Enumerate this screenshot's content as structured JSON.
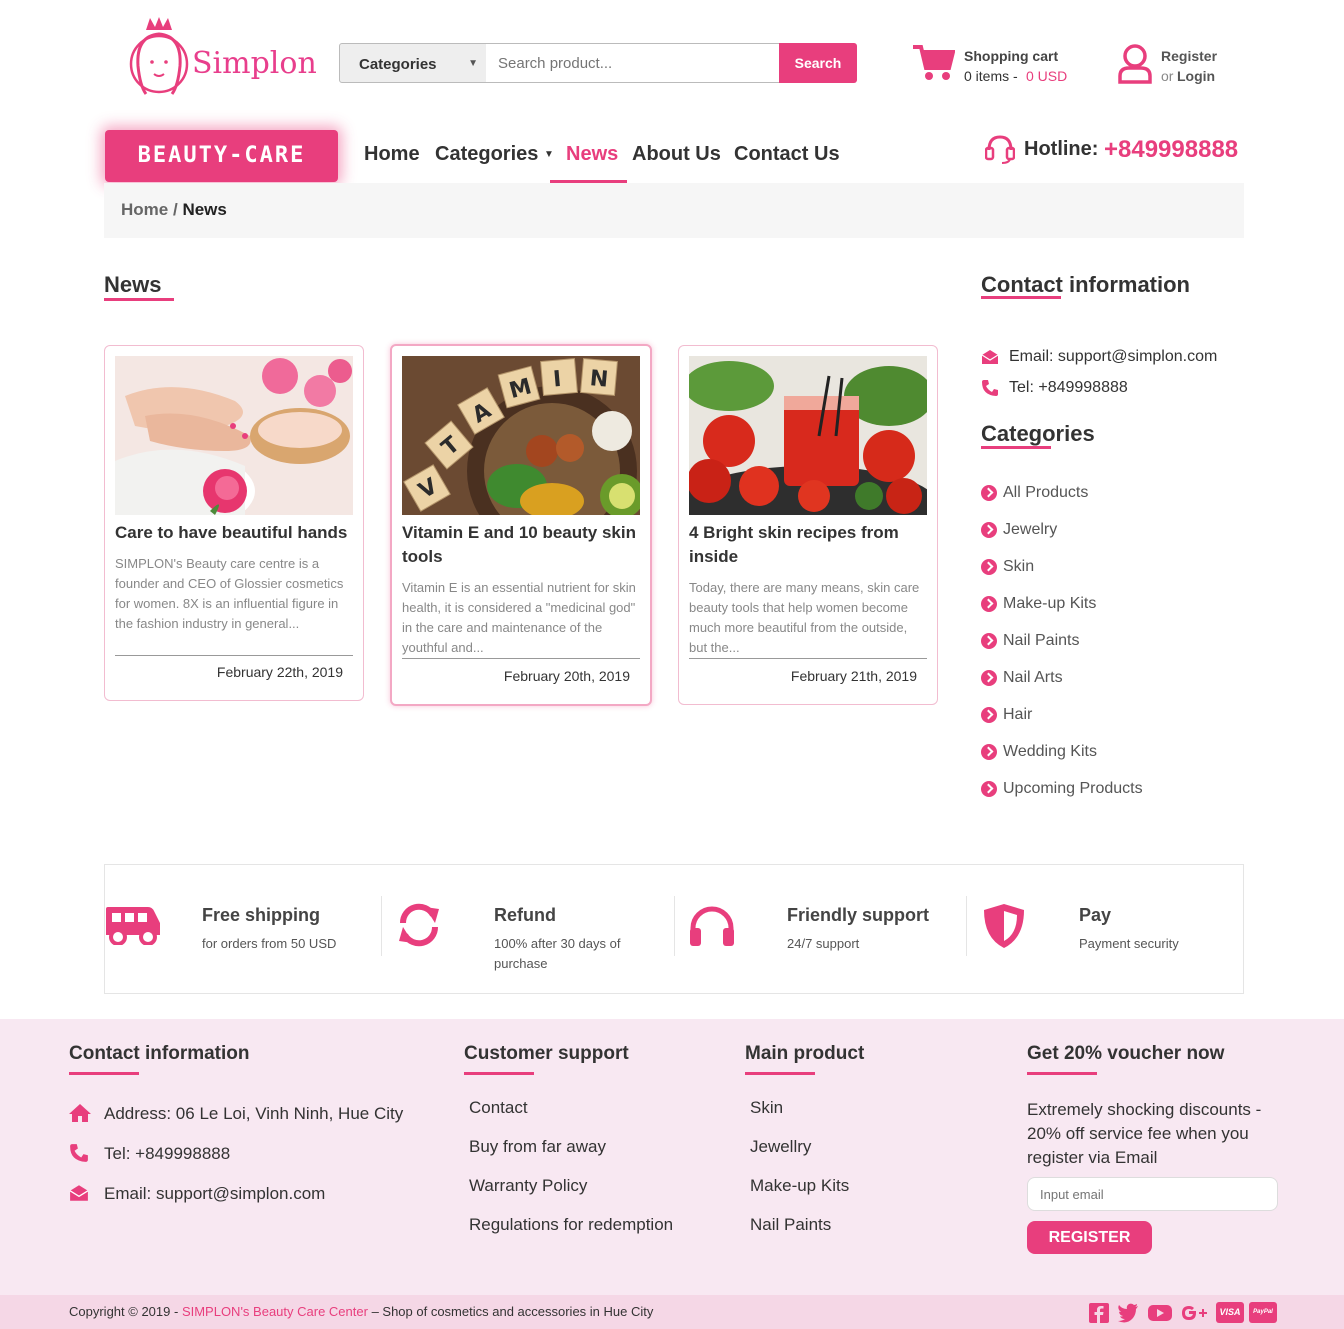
{
  "header": {
    "brand": "Simplon",
    "categories_label": "Categories",
    "search_placeholder": "Search product...",
    "search_button": "Search",
    "cart_title": "Shopping cart",
    "cart_items": "0 items -",
    "cart_total": "0 USD",
    "register_label": "Register",
    "or_label": "or",
    "login_label": "Login"
  },
  "nav": {
    "badge": "BEAUTY-CARE",
    "items": [
      {
        "label": "Home"
      },
      {
        "label": "Categories"
      },
      {
        "label": "News"
      },
      {
        "label": "About Us"
      },
      {
        "label": "Contact Us"
      }
    ],
    "hotline_label": "Hotline:",
    "hotline_number": "+849998888"
  },
  "breadcrumb": {
    "home": "Home",
    "sep": "/",
    "current": "News"
  },
  "news": {
    "title": "News",
    "cards": [
      {
        "title": "Care to have beautiful hands",
        "excerpt": "SIMPLON's Beauty care centre is a founder and CEO of Glossier cosmetics for women. 8X is an influential figure in the fashion industry in general...",
        "date": "February 22th, 2019"
      },
      {
        "title": "Vitamin E and 10 beauty skin tools",
        "excerpt": "Vitamin E is an essential nutrient for skin health, it is considered a \"medicinal god\" in the care and maintenance of the youthful and...",
        "date": "February 20th, 2019"
      },
      {
        "title": "4 Bright skin recipes from inside",
        "excerpt": "Today, there are many means, skin care beauty tools that help women become much more beautiful from the outside, but the...",
        "date": "February 21th, 2019"
      }
    ]
  },
  "sidebar": {
    "contact_title": "Contact information",
    "email": "Email: support@simplon.com",
    "tel": "Tel: +849998888",
    "categories_title": "Categories",
    "categories": [
      "All Products",
      "Jewelry",
      "Skin",
      "Make-up Kits",
      "Nail Paints",
      "Nail Arts",
      "Hair",
      "Wedding Kits",
      "Upcoming Products"
    ]
  },
  "features": [
    {
      "title": "Free shipping",
      "sub": "for orders from 50 USD"
    },
    {
      "title": "Refund",
      "sub": "100% after 30 days of purchase"
    },
    {
      "title": "Friendly support",
      "sub": "24/7 support"
    },
    {
      "title": "Pay",
      "sub": "Payment security"
    }
  ],
  "footer": {
    "contact_title": "Contact information",
    "address": "Address: 06 Le Loi, Vinh Ninh, Hue City",
    "tel": "Tel: +849998888",
    "email": "Email: support@simplon.com",
    "support_title": "Customer support",
    "support_links": [
      "Contact",
      "Buy from far away",
      "Warranty Policy",
      "Regulations for redemption"
    ],
    "product_title": "Main product",
    "product_links": [
      "Skin",
      "Jewellry",
      "Make-up Kits",
      "Nail Paints"
    ],
    "voucher_title": "Get 20% voucher now",
    "voucher_text": "Extremely shocking discounts - 20% off service fee when you register via Email",
    "email_placeholder": "Input email",
    "register_button": "REGISTER",
    "copyright_prefix": "Copyright © 2019 -",
    "copyright_brand": "SIMPLON's Beauty Care Center",
    "copyright_suffix": "– Shop of cosmetics and accessories in Hue City",
    "visa": "VISA",
    "paypal": "PayPal"
  },
  "colors": {
    "accent": "#e83e7d",
    "footer_bg": "#f8e8f2"
  }
}
